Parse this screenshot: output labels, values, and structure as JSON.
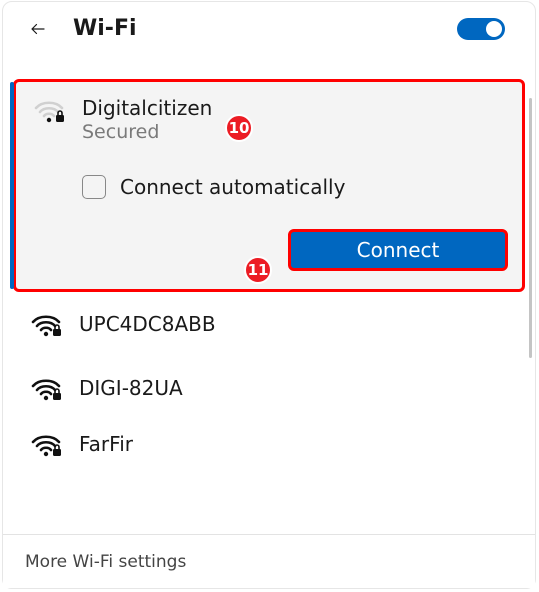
{
  "header": {
    "title": "Wi-Fi"
  },
  "toggle": {
    "on": true
  },
  "selected": {
    "name": "Digitalcitizen",
    "status": "Secured",
    "auto_label": "Connect automatically",
    "connect_label": "Connect"
  },
  "networks": [
    {
      "name": "UPC4DC8ABB",
      "secured": true
    },
    {
      "name": "DIGI-82UA",
      "secured": true
    },
    {
      "name": "FarFir",
      "secured": true
    }
  ],
  "footer": {
    "more_label": "More Wi-Fi settings"
  },
  "annotations": {
    "badge1": "10",
    "badge2": "11"
  }
}
